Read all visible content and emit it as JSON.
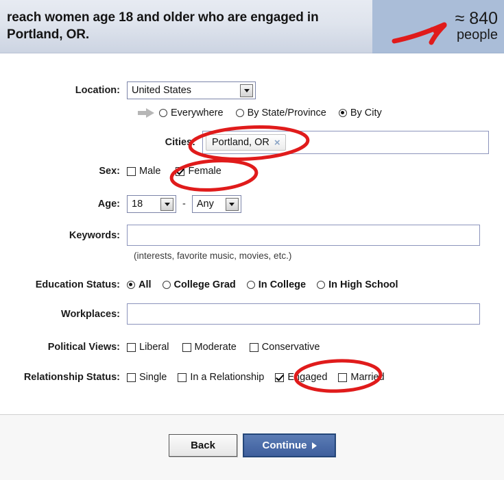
{
  "header": {
    "title": "reach women age 18 and older who are engaged in Portland, OR.",
    "count_value": "≈ 840",
    "count_label": "people",
    "left_bg": "#dfe4ed",
    "right_bg": "#aabdd8"
  },
  "form": {
    "location": {
      "label": "Location:",
      "selected": "United States",
      "scope_options": [
        {
          "label": "Everywhere",
          "selected": false
        },
        {
          "label": "By State/Province",
          "selected": false
        },
        {
          "label": "By City",
          "selected": true
        }
      ]
    },
    "cities": {
      "label": "Cities:",
      "value": "",
      "tokens": [
        {
          "text": "Portland, OR",
          "remove": "×"
        }
      ]
    },
    "sex": {
      "label": "Sex:",
      "options": [
        {
          "label": "Male",
          "checked": false
        },
        {
          "label": "Female",
          "checked": true
        }
      ]
    },
    "age": {
      "label": "Age:",
      "from": "18",
      "separator": "-",
      "to": "Any"
    },
    "keywords": {
      "label": "Keywords:",
      "value": "",
      "hint": "(interests, favorite music, movies, etc.)"
    },
    "education": {
      "label": "Education Status:",
      "options": [
        {
          "label": "All",
          "selected": true
        },
        {
          "label": "College Grad",
          "selected": false
        },
        {
          "label": "In College",
          "selected": false
        },
        {
          "label": "In High School",
          "selected": false
        }
      ]
    },
    "workplaces": {
      "label": "Workplaces:",
      "value": ""
    },
    "political": {
      "label": "Political Views:",
      "options": [
        {
          "label": "Liberal",
          "checked": false
        },
        {
          "label": "Moderate",
          "checked": false
        },
        {
          "label": "Conservative",
          "checked": false
        }
      ]
    },
    "relationship": {
      "label": "Relationship Status:",
      "options": [
        {
          "label": "Single",
          "checked": false
        },
        {
          "label": "In a Relationship",
          "checked": false
        },
        {
          "label": "Engaged",
          "checked": true
        },
        {
          "label": "Married",
          "checked": false
        }
      ]
    }
  },
  "footer": {
    "back_label": "Back",
    "continue_label": "Continue"
  },
  "annotations": {
    "color": "#e01b1b",
    "marks": [
      "arrow-to-count",
      "circle-portland-token",
      "circle-female-checkbox",
      "circle-engaged-checkbox"
    ]
  }
}
